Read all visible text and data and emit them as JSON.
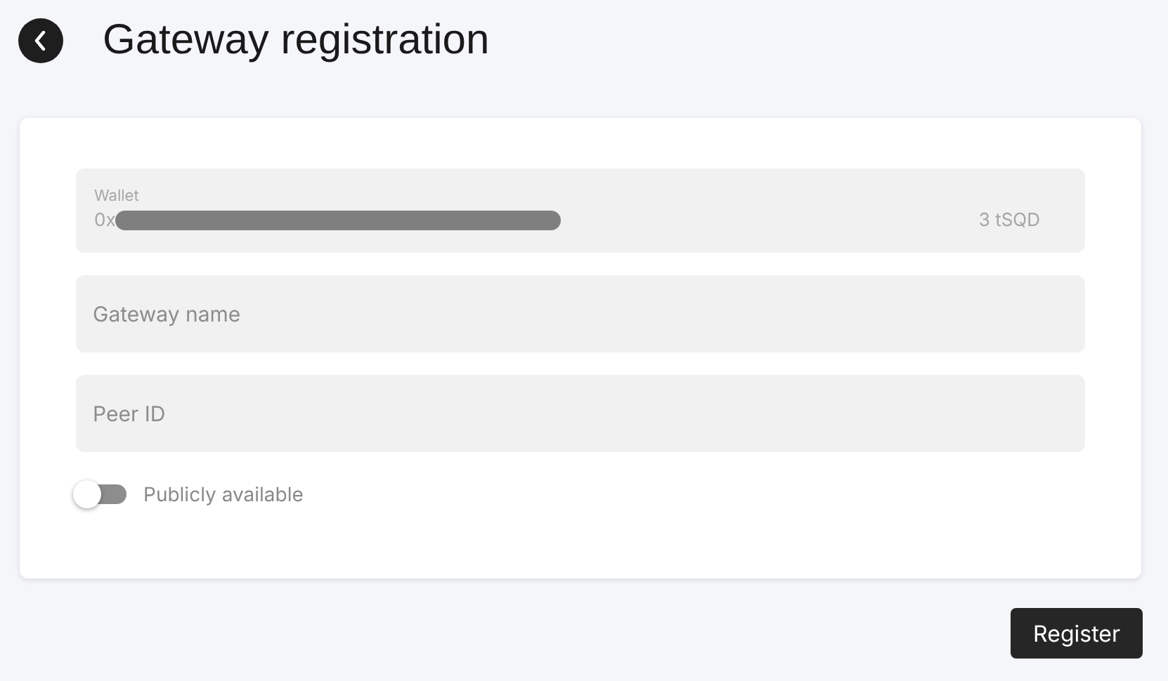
{
  "title": "Gateway registration",
  "wallet": {
    "label": "Wallet",
    "prefix": "0x",
    "balance": "3 tSQD"
  },
  "fields": [
    {
      "placeholder": "Gateway name"
    },
    {
      "placeholder": "Peer ID"
    }
  ],
  "toggle": {
    "label": "Publicly available",
    "on": false
  },
  "buttons": [
    "Register"
  ]
}
